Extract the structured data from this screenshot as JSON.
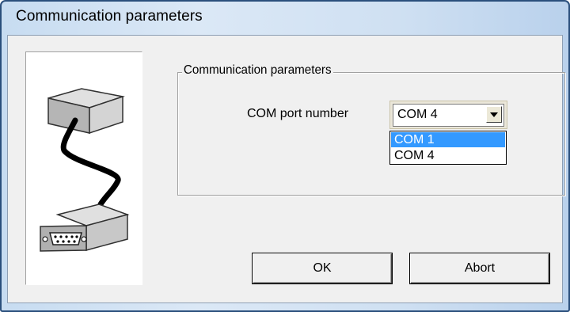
{
  "window": {
    "title": "Communication parameters"
  },
  "group": {
    "legend": "Communication parameters"
  },
  "com_port": {
    "label": "COM port number",
    "value": "COM 4",
    "options": [
      "COM 1",
      "COM 4"
    ],
    "highlighted_option": "COM 1"
  },
  "buttons": {
    "ok_label": "OK",
    "abort_label": "Abort"
  },
  "colors": {
    "selection": "#3399ff",
    "dialog_bg": "#f0f0f0"
  },
  "icons": {
    "image": "serial-cable-icon",
    "combo_arrow": "chevron-down-icon"
  }
}
